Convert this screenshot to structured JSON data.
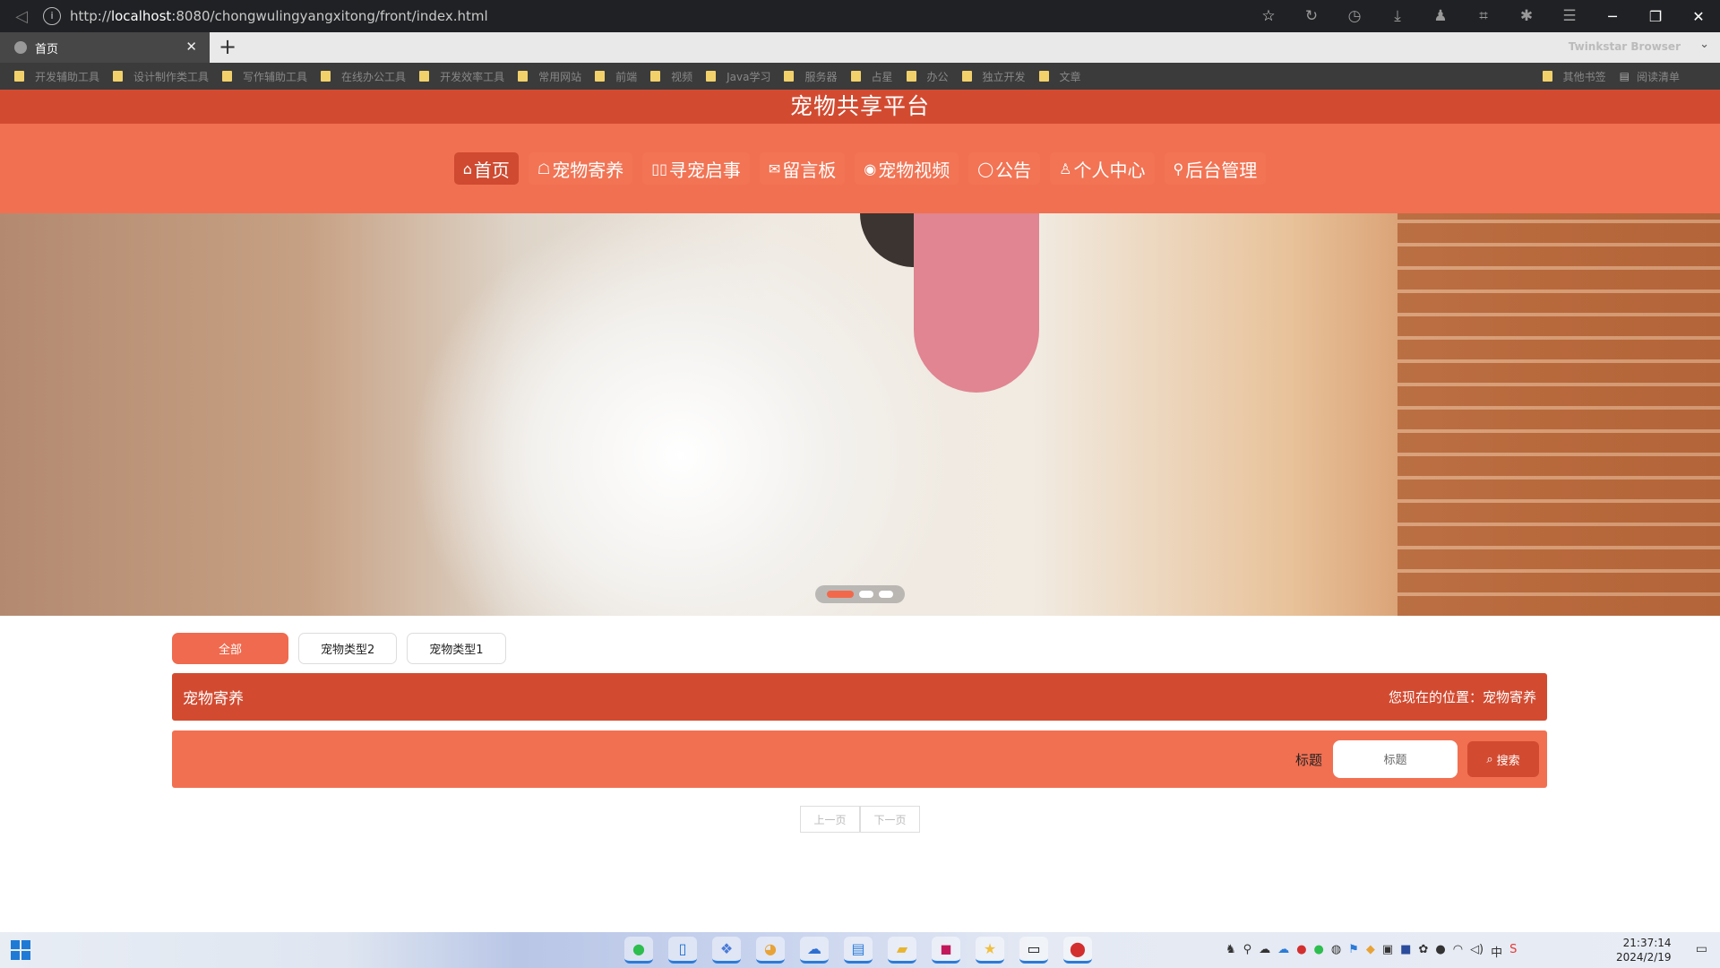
{
  "browser": {
    "url_prefix": "http://",
    "url_host": "localhost",
    "url_rest": ":8080/chongwulingyangxitong/front/index.html",
    "tab_title": "首页",
    "brand": "Twinkstar Browser",
    "bookmarks": [
      "开发辅助工具",
      "设计制作类工具",
      "写作辅助工具",
      "在线办公工具",
      "开发效率工具",
      "常用网站",
      "前端",
      "视频",
      "Java学习",
      "服务器",
      "占星",
      "办公",
      "独立开发",
      "文章"
    ],
    "bookmarks_right": [
      "其他书签",
      "阅读清单"
    ]
  },
  "site": {
    "title": "宠物共享平台",
    "nav": [
      {
        "icon": "⌂",
        "label": "首页",
        "active": true
      },
      {
        "icon": "☖",
        "label": "宠物寄养"
      },
      {
        "icon": "▯▯",
        "label": "寻宠启事"
      },
      {
        "icon": "✉",
        "label": "留言板"
      },
      {
        "icon": "◉",
        "label": "宠物视频"
      },
      {
        "icon": "◯",
        "label": "公告"
      },
      {
        "icon": "♙",
        "label": "个人中心"
      },
      {
        "icon": "⚲",
        "label": "后台管理"
      }
    ]
  },
  "filters": [
    "全部",
    "宠物类型2",
    "宠物类型1"
  ],
  "section": {
    "title": "宠物寄养",
    "crumb": "您现在的位置：宠物寄养"
  },
  "search": {
    "label": "标题",
    "placeholder": "标题",
    "button": "搜索"
  },
  "pager": {
    "prev": "上一页",
    "next": "下一页"
  },
  "taskbar": {
    "time": "21:37:14",
    "date": "2024/2/19"
  },
  "colors": {
    "primary": "#d24b31",
    "accent": "#f17052"
  }
}
